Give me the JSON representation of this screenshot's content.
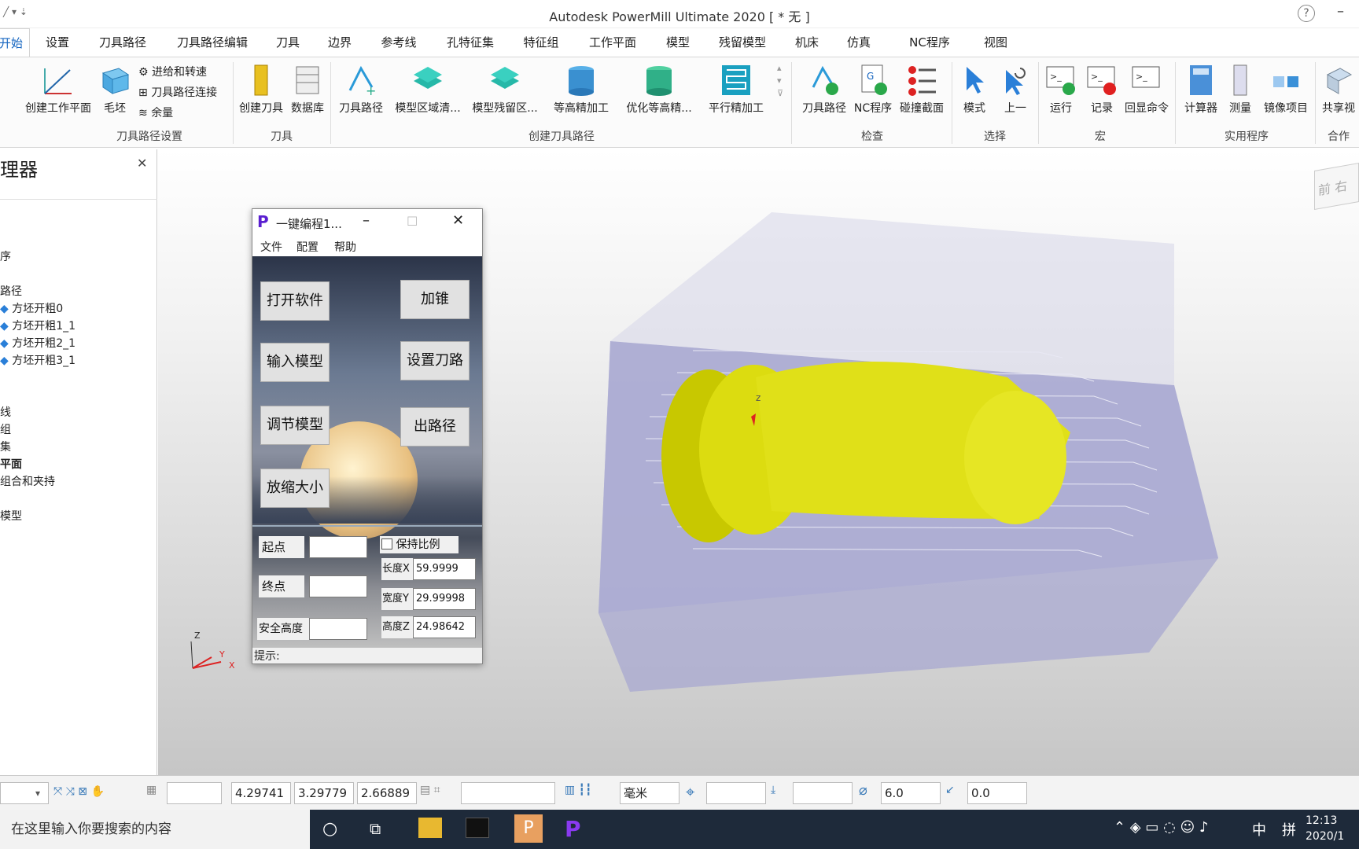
{
  "window": {
    "title": "Autodesk PowerMill Ultimate 2020    [ * 无 ]"
  },
  "tabs": [
    "开始",
    "设置",
    "刀具路径",
    "刀具路径编辑",
    "刀具",
    "边界",
    "参考线",
    "孔特征集",
    "特征组",
    "工作平面",
    "模型",
    "残留模型",
    "机床",
    "仿真",
    "NC程序",
    "视图"
  ],
  "ribbon": {
    "toolpath_setup": {
      "create_workplane": "创建工作平面",
      "block": "毛坯",
      "feeds": "进给和转速",
      "toolpath_connections": "刀具路径连接",
      "thickness": "余量",
      "label": "刀具路径设置"
    },
    "tool": {
      "create_tool": "创建刀具",
      "database": "数据库",
      "label": "刀具"
    },
    "create_toolpath": {
      "toolpath": "刀具路径",
      "model_area_clear": "模型区域清...",
      "model_rest": "模型残留区...",
      "const_z": "等高精加工",
      "opt_const_z": "优化等高精...",
      "raster": "平行精加工",
      "label": "创建刀具路径"
    },
    "verify": {
      "toolpath": "刀具路径",
      "nc_program": "NC程序",
      "collision": "碰撞截面",
      "label": "检查"
    },
    "select": {
      "mode": "模式",
      "previous": "上一",
      "label": "选择"
    },
    "macro": {
      "run": "运行",
      "record": "记录",
      "echo": "回显命令",
      "label": "宏"
    },
    "utilities": {
      "calculator": "计算器",
      "measure": "测量",
      "mirror": "镜像项目",
      "label": "实用程序"
    },
    "collab": {
      "share": "共享视",
      "label": "合作"
    }
  },
  "explorer": {
    "title": "理器",
    "items": [
      "序",
      "路径",
      "方坯开粗0",
      "方坯开粗1_1",
      "方坯开粗2_1",
      "方坯开粗3_1",
      "线",
      "组",
      "集",
      "平面",
      "组合和夹持",
      "模型"
    ]
  },
  "dialog": {
    "title": "一键编程1...",
    "menu": [
      "文件",
      "配置",
      "帮助"
    ],
    "buttons": {
      "open_software": "打开软件",
      "add_taper": "加锥",
      "import_model": "输入模型",
      "set_toolpath": "设置刀路",
      "adjust_model": "调节模型",
      "output_path": "出路径",
      "scale": "放缩大小"
    },
    "fields": {
      "start_label": "起点",
      "start_value": "",
      "end_label": "终点",
      "end_value": "",
      "safe_height_label": "安全高度",
      "safe_height_value": "",
      "keep_ratio": "保持比例",
      "length_label": "长度X",
      "length_value": "59.9999",
      "width_label": "宽度Y",
      "width_value": "29.99998",
      "height_label": "高度Z",
      "height_value": "24.98642"
    },
    "hint": "提示:"
  },
  "viewport": {
    "axis_z": "Z",
    "axis_y": "Y",
    "axis_x": "X",
    "view_cube": "前 右"
  },
  "statusbar": {
    "x": "4.29741",
    "y": "3.29779",
    "z": "2.66889",
    "units": "毫米",
    "tool_diameter": "6.0",
    "tolerance": "0.0"
  },
  "taskbar": {
    "search": "在这里输入你要搜索的内容",
    "ime": "中",
    "layout": "拼",
    "time": "12:13",
    "date": "2020/1"
  },
  "colors": {
    "accent": "#1565c0",
    "model": "#e6e600",
    "block": "#b0b0d8"
  }
}
